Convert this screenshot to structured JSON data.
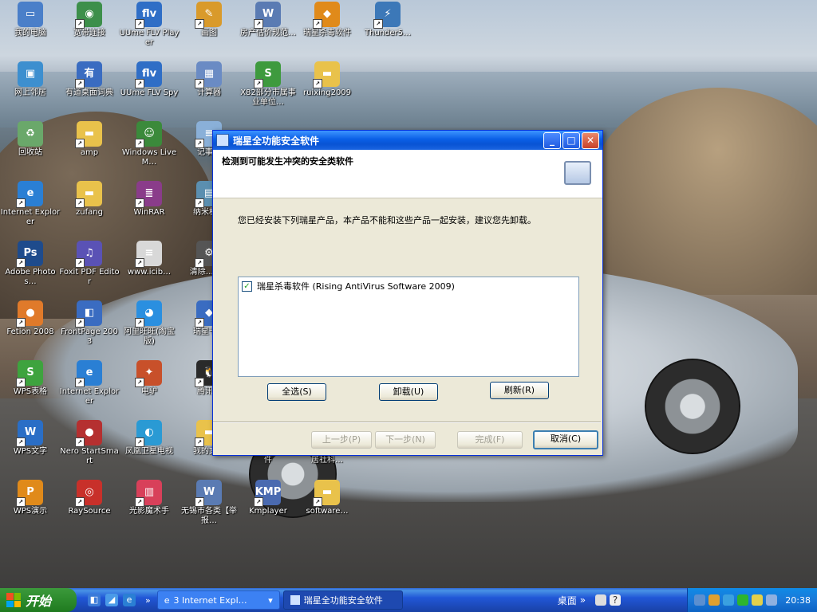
{
  "desktop_icons": [
    {
      "label": "我的电脑",
      "icon": "my-computer-icon",
      "color": "#4a7fc9",
      "glyph": "▭"
    },
    {
      "label": "宽带连接",
      "icon": "broadband-connection-icon",
      "color": "#3d8f4a",
      "glyph": "◉"
    },
    {
      "label": "UUme FLV Player",
      "icon": "flv-player-icon",
      "color": "#2f6ec6",
      "glyph": "flv"
    },
    {
      "label": "画图",
      "icon": "paint-icon",
      "color": "#d99a2b",
      "glyph": "✎"
    },
    {
      "label": "房产估价规范…",
      "icon": "word-document-icon",
      "color": "#5a7bb3",
      "glyph": "W"
    },
    {
      "label": "瑞星杀毒软件",
      "icon": "rising-antivirus-icon",
      "color": "#e08a1a",
      "glyph": "◆"
    },
    {
      "label": "Thunder5…",
      "icon": "thunder-icon",
      "color": "#3c78b8",
      "glyph": "⚡"
    },
    {
      "label": "网上邻居",
      "icon": "network-places-icon",
      "color": "#3d8fcf",
      "glyph": "▣"
    },
    {
      "label": "有道桌面词典",
      "icon": "youdao-dict-icon",
      "color": "#3a6cc1",
      "glyph": "有"
    },
    {
      "label": "UUme FLV Spy",
      "icon": "flv-spy-icon",
      "color": "#2f6ec6",
      "glyph": "flv"
    },
    {
      "label": "计算器",
      "icon": "calculator-icon",
      "color": "#6a8bc4",
      "glyph": "▦"
    },
    {
      "label": "X82部分市属事业单位…",
      "icon": "excel-document-icon",
      "color": "#3e9a3e",
      "glyph": "S"
    },
    {
      "label": "ruixing2009",
      "icon": "folder-icon",
      "color": "#e9c24b",
      "glyph": "▬"
    },
    {
      "label": "回收站",
      "icon": "recycle-bin-icon",
      "color": "#6aa86a",
      "glyph": "♻"
    },
    {
      "label": "amp",
      "icon": "folder-icon",
      "color": "#e9c24b",
      "glyph": "▬"
    },
    {
      "label": "Windows Live M…",
      "icon": "windows-live-messenger-icon",
      "color": "#3b8a3b",
      "glyph": "☺"
    },
    {
      "label": "记事本",
      "icon": "notepad-icon",
      "color": "#8ab0d8",
      "glyph": "≡"
    },
    {
      "label": "Internet Explorer",
      "icon": "internet-explorer-icon",
      "color": "#2a7fd4",
      "glyph": "e"
    },
    {
      "label": "zufang",
      "icon": "folder-icon",
      "color": "#e9c24b",
      "glyph": "▬"
    },
    {
      "label": "WinRAR",
      "icon": "winrar-icon",
      "color": "#8a3c8a",
      "glyph": "≣"
    },
    {
      "label": "纳米机…",
      "icon": "nano-app-icon",
      "color": "#5b8fb0",
      "glyph": "▤"
    },
    {
      "label": "Adobe Photos…",
      "icon": "photoshop-icon",
      "color": "#1e4b8c",
      "glyph": "Ps"
    },
    {
      "label": "Foxit PDF Editor",
      "icon": "foxit-pdf-editor-icon",
      "color": "#5a52b5",
      "glyph": "♫"
    },
    {
      "label": "www.icib…",
      "icon": "text-document-icon",
      "color": "#d8d8d8",
      "glyph": "≡"
    },
    {
      "label": "清除…LJ…",
      "icon": "cleaner-icon",
      "color": "#555555",
      "glyph": "⚙"
    },
    {
      "label": "Fetion 2008",
      "icon": "fetion-icon",
      "color": "#e07a2a",
      "glyph": "●"
    },
    {
      "label": "FrontPage 2003",
      "icon": "frontpage-icon",
      "color": "#3a6cc1",
      "glyph": "◧"
    },
    {
      "label": "阿里旺旺(淘宝版)",
      "icon": "aliwangwang-icon",
      "color": "#2a8fe0",
      "glyph": "◕"
    },
    {
      "label": "瑞星卡…",
      "icon": "rising-card-icon",
      "color": "#3a6cc1",
      "glyph": "◆"
    },
    {
      "label": "WPS表格",
      "icon": "wps-spreadsheet-icon",
      "color": "#3ea33e",
      "glyph": "S"
    },
    {
      "label": "Internet Explorer",
      "icon": "internet-explorer-icon",
      "color": "#2a7fd4",
      "glyph": "e"
    },
    {
      "label": "电驴",
      "icon": "emule-icon",
      "color": "#c8502a",
      "glyph": "✦"
    },
    {
      "label": "腾讯…",
      "icon": "qq-icon",
      "color": "#2a2a2a",
      "glyph": "🐧"
    },
    {
      "label": "WPS文字",
      "icon": "wps-writer-icon",
      "color": "#2a6ec6",
      "glyph": "W"
    },
    {
      "label": "Nero StartSmart",
      "icon": "nero-icon",
      "color": "#b53030",
      "glyph": "●"
    },
    {
      "label": "凤凰卫星电视",
      "icon": "phoenix-tv-icon",
      "color": "#2a9ad4",
      "glyph": "◐"
    },
    {
      "label": "我的文档",
      "icon": "my-documents-icon",
      "color": "#e9c24b",
      "glyph": "▬"
    },
    {
      "label": "WPS演示",
      "icon": "wps-presentation-icon",
      "color": "#e08a1a",
      "glyph": "P"
    },
    {
      "label": "RaySource",
      "icon": "raysource-icon",
      "color": "#c8302a",
      "glyph": "◎"
    },
    {
      "label": "光影魔术手",
      "icon": "neoimaging-icon",
      "color": "#d8405a",
      "glyph": "▥"
    },
    {
      "label": "无锡市各类【举报…",
      "icon": "word-document-icon",
      "color": "#5a7bb3",
      "glyph": "W"
    },
    {
      "label": "Kmplayer",
      "icon": "kmplayer-icon",
      "color": "#4a6ab0",
      "glyph": "KMP"
    },
    {
      "label": "software…",
      "icon": "folder-icon",
      "color": "#e9c24b",
      "glyph": "▬"
    }
  ],
  "partial_labels": {
    "behind_dialog_1": "件",
    "behind_dialog_2": "居社科…"
  },
  "dialog": {
    "title": "瑞星全功能安全软件",
    "heading": "检测到可能发生冲突的安全类软件",
    "message": "您已经安装下列瑞星产品，本产品不能和这些产品一起安装，建议您先卸载。",
    "items": [
      {
        "label": "瑞星杀毒软件 (Rising AntiVirus Software 2009)",
        "checked": true
      }
    ],
    "buttons": {
      "select_all": "全选(S)",
      "uninstall": "卸载(U)",
      "refresh": "刷新(R)",
      "back": "上一步(P)",
      "next": "下一步(N)",
      "finish": "完成(F)",
      "cancel": "取消(C)"
    },
    "title_buttons": {
      "minimize": "_",
      "maximize": "□",
      "close": "✕"
    }
  },
  "taskbar": {
    "start_label": "开始",
    "tasks": [
      {
        "label": "3 Internet Expl…",
        "icon": "internet-explorer-icon"
      },
      {
        "label": "瑞星全功能安全软件",
        "icon": "rising-dialog-icon"
      }
    ],
    "deskbar_label": "桌面",
    "clock": "20:38"
  }
}
